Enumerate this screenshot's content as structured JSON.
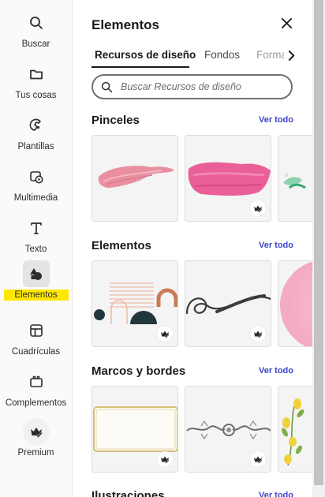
{
  "rail": {
    "items": [
      {
        "label": "Buscar",
        "icon": "search-icon"
      },
      {
        "label": "Tus cosas",
        "icon": "folder-icon"
      },
      {
        "label": "Plantillas",
        "icon": "templates-icon"
      },
      {
        "label": "Multimedia",
        "icon": "media-icon"
      },
      {
        "label": "Texto",
        "icon": "text-icon"
      },
      {
        "label": "Elementos",
        "icon": "elements-icon"
      },
      {
        "label": "Cuadrículas",
        "icon": "grids-icon"
      },
      {
        "label": "Complementos",
        "icon": "addons-icon"
      },
      {
        "label": "Premium",
        "icon": "premium-crown-icon"
      }
    ],
    "active": "Elementos",
    "highlight_color": "#ffe700"
  },
  "panel": {
    "title": "Elementos",
    "tabs": [
      {
        "label": "Recursos de diseño",
        "active": true
      },
      {
        "label": "Fondos",
        "active": false
      },
      {
        "label": "Formas",
        "active": false
      }
    ],
    "search_placeholder": "Buscar Recursos de diseño",
    "see_all_label": "Ver todo",
    "sections": [
      {
        "title": "Pinceles"
      },
      {
        "title": "Elementos"
      },
      {
        "title": "Marcos y bordes"
      },
      {
        "title": "Ilustraciones"
      }
    ]
  },
  "colors": {
    "accent_link": "#3b46c6",
    "brush_pink": "#e98fa0",
    "brush_magenta": "#ea5f97"
  }
}
